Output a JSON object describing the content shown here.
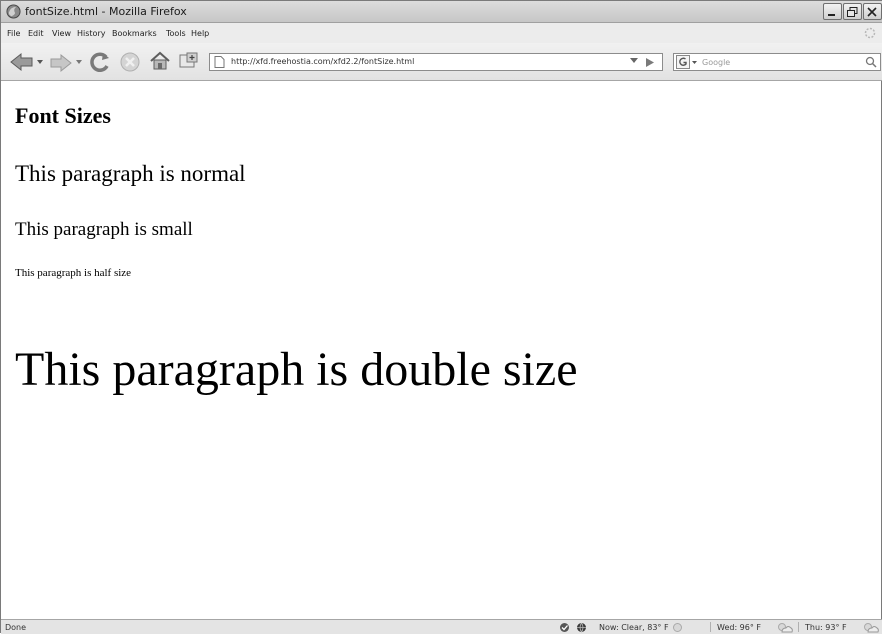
{
  "window": {
    "title": "fontSize.html - Mozilla Firefox"
  },
  "menu": {
    "items": [
      "File",
      "Edit",
      "View",
      "History",
      "Bookmarks",
      "Tools",
      "Help"
    ]
  },
  "navigation": {
    "url": "http://xfd.freehostia.com/xfd2.2/fontSize.html",
    "search_placeholder": "Google"
  },
  "page": {
    "heading": "Font Sizes",
    "paragraphs": {
      "normal": "This paragraph is normal",
      "small": "This paragraph is small",
      "half": "This paragraph is half size",
      "double": "This paragraph is double size"
    }
  },
  "status": {
    "text": "Done",
    "weather_now": "Now: Clear, 83° F",
    "weather_wed": "Wed: 96° F",
    "weather_thu": "Thu: 93° F"
  },
  "icons": {
    "app": "firefox-icon",
    "back": "back-arrow-icon",
    "forward": "forward-arrow-icon",
    "reload": "reload-icon",
    "stop": "stop-icon",
    "home": "home-icon",
    "bookmark": "bookmark-page-icon"
  }
}
